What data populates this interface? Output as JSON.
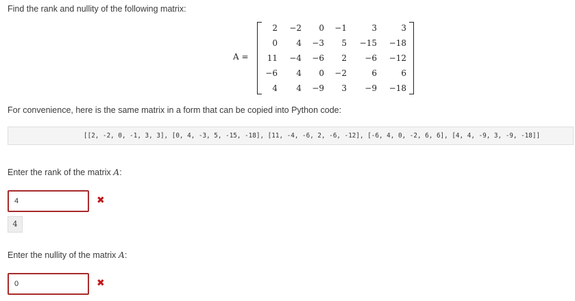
{
  "question": {
    "prompt": "Find the rank and nullity of the following matrix:",
    "matrix_label": "A =",
    "matrix_rows": [
      [
        "2",
        "−2",
        "0",
        "−1",
        "3",
        "3"
      ],
      [
        "0",
        "4",
        "−3",
        "5",
        "−15",
        "−18"
      ],
      [
        "11",
        "−4",
        "−6",
        "2",
        "−6",
        "−12"
      ],
      [
        "−6",
        "4",
        "0",
        "−2",
        "6",
        "6"
      ],
      [
        "4",
        "4",
        "−9",
        "3",
        "−9",
        "−18"
      ]
    ],
    "copy_note": "For convenience, here is the same matrix in a form that can be copied into Python code:",
    "python_code": "[[2, -2, 0, -1, 3, 3], [0, 4, -3, 5, -15, -18], [11, -4, -6, 2, -6, -12], [-6, 4, 0, -2, 6, 6], [4, 4, -9, 3, -9, -18]]"
  },
  "rank_part": {
    "label_prefix": "Enter the rank of the matrix ",
    "label_var": "A",
    "label_suffix": ":",
    "input_value": "4",
    "status_icon": "✖",
    "preview_value": "4"
  },
  "nullity_part": {
    "label_prefix": "Enter the nullity of the matrix ",
    "label_var": "A",
    "label_suffix": ":",
    "input_value": "0",
    "status_icon": "✖"
  },
  "colors": {
    "error_border": "#a82a2a",
    "error_icon": "#c0181b"
  }
}
